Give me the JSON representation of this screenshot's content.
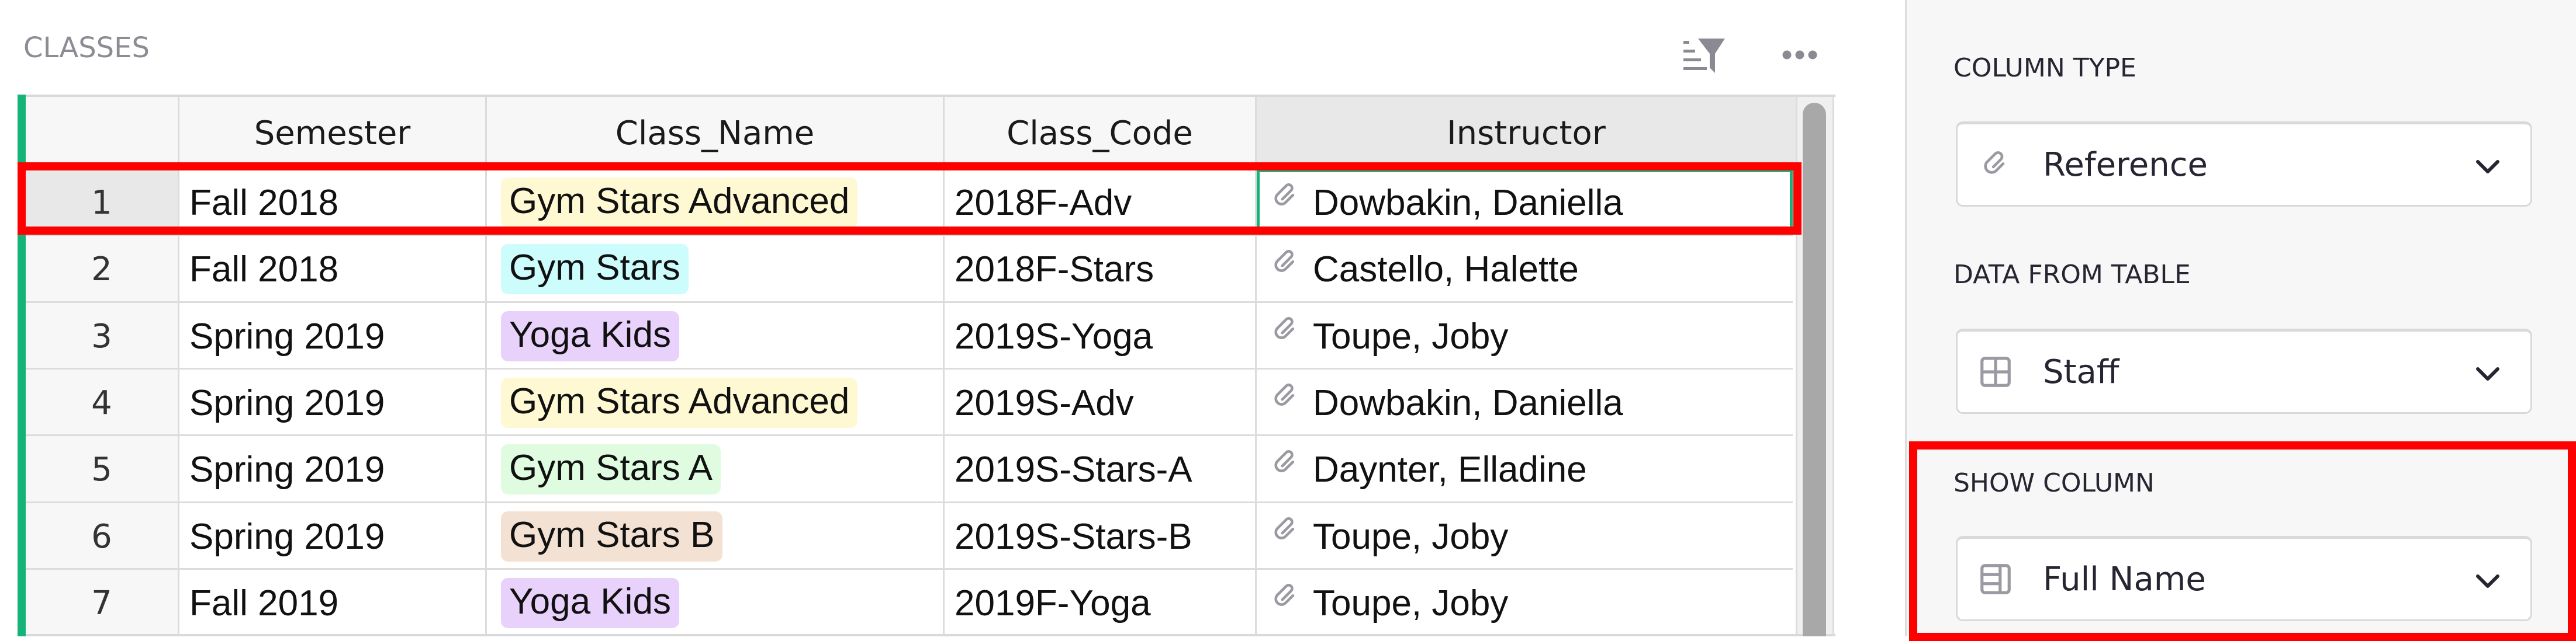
{
  "section": {
    "title": "CLASSES",
    "toolbar": {
      "sort_filter_icon": "sort-filter-icon",
      "more_icon": "more-horizontal-icon"
    }
  },
  "grid": {
    "columns": [
      "Semester",
      "Class_Name",
      "Class_Code",
      "Instructor"
    ],
    "selected_column": "Instructor",
    "active_row": 1,
    "rows": [
      {
        "num": "1",
        "semester": "Fall 2018",
        "class_name": "Gym Stars Advanced",
        "class_code": "2018F-Adv",
        "instructor": "Dowbakin, Daniella"
      },
      {
        "num": "2",
        "semester": "Fall 2018",
        "class_name": "Gym Stars",
        "class_code": "2018F-Stars",
        "instructor": "Castello, Halette"
      },
      {
        "num": "3",
        "semester": "Spring 2019",
        "class_name": "Yoga Kids",
        "class_code": "2019S-Yoga",
        "instructor": "Toupe, Joby"
      },
      {
        "num": "4",
        "semester": "Spring 2019",
        "class_name": "Gym Stars Advanced",
        "class_code": "2019S-Adv",
        "instructor": "Dowbakin, Daniella"
      },
      {
        "num": "5",
        "semester": "Spring 2019",
        "class_name": "Gym Stars A",
        "class_code": "2019S-Stars-A",
        "instructor": "Daynter, Elladine"
      },
      {
        "num": "6",
        "semester": "Spring 2019",
        "class_name": "Gym Stars B",
        "class_code": "2019S-Stars-B",
        "instructor": "Toupe, Joby"
      },
      {
        "num": "7",
        "semester": "Fall 2019",
        "class_name": "Yoga Kids",
        "class_code": "2019F-Yoga",
        "instructor": "Toupe, Joby"
      }
    ],
    "choice_colors": {
      "Gym Stars Advanced": "#fef9d3",
      "Gym Stars": "#ccfcfc",
      "Yoga Kids": "#e8d2fc",
      "Gym Stars A": "#e0fce0",
      "Gym Stars B": "#f3e2d3"
    },
    "reference_icon": "link-icon"
  },
  "colors": {
    "accent_green": "#16b378",
    "highlight_red": "#ff0000"
  },
  "right_panel": {
    "column_type": {
      "label": "COLUMN TYPE",
      "value": "Reference",
      "icon": "link-icon"
    },
    "data_from_table": {
      "label": "DATA FROM TABLE",
      "value": "Staff",
      "icon": "table-icon"
    },
    "show_column": {
      "label": "SHOW COLUMN",
      "value": "Full Name",
      "icon": "column-icon"
    }
  }
}
